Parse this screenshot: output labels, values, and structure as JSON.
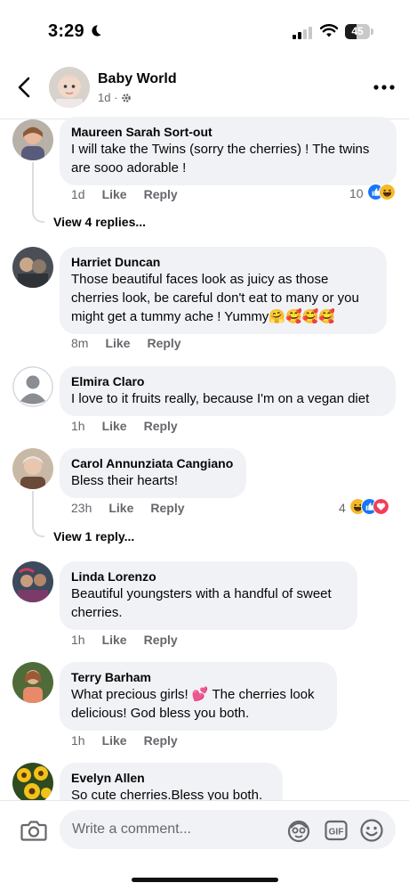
{
  "status": {
    "time": "3:29",
    "battery": "45",
    "battery_level": 0.45
  },
  "header": {
    "title": "Baby World",
    "meta": "1d ·"
  },
  "comments": [
    {
      "name": "Maureen Sarah Sort-out",
      "text": "I will take the Twins (sorry the cherries) ! The twins are sooo adorable !",
      "time": "1d",
      "like": "Like",
      "reply": "Reply",
      "reaction_count": "10",
      "view_replies": "View 4 replies..."
    },
    {
      "name": "Harriet Duncan",
      "text": "Those beautiful faces look as juicy as those cherries look, be careful don't eat to many or you might get  a tummy ache ! Yummy🤗🥰🥰🥰",
      "time": "8m",
      "like": "Like",
      "reply": "Reply"
    },
    {
      "name": "Elmira Claro",
      "text": "I love to it fruits really, because I'm on a vegan diet",
      "time": "1h",
      "like": "Like",
      "reply": "Reply"
    },
    {
      "name": "Carol Annunziata Cangiano",
      "text": "Bless their hearts!",
      "time": "23h",
      "like": "Like",
      "reply": "Reply",
      "reaction_count": "4",
      "view_replies": "View 1 reply..."
    },
    {
      "name": "Linda Lorenzo",
      "text": "Beautiful youngsters with a handful of sweet cherries.",
      "time": "1h",
      "like": "Like",
      "reply": "Reply"
    },
    {
      "name": "Terry Barham",
      "text": "What precious girls! 💕 The cherries look delicious! God bless you both.",
      "time": "1h",
      "like": "Like",
      "reply": "Reply"
    },
    {
      "name": "Evelyn Allen",
      "text": "So cute cherries.Bless you both."
    }
  ],
  "composer": {
    "placeholder": "Write a comment..."
  },
  "icons": {
    "back": "chevron-left-icon",
    "more": "more-dots-icon",
    "settings": "gear-icon",
    "camera": "camera-icon",
    "avatar_sticker": "avatar-sticker-icon",
    "gif": "gif-icon",
    "emoji": "smile-icon",
    "reactions": [
      "like-reaction-icon",
      "haha-reaction-icon",
      "love-reaction-icon"
    ]
  },
  "colors": {
    "like_blue": "#1877f2",
    "love_red": "#f33e58",
    "haha_yellow": "#f7b928",
    "bubble_bg": "#f0f2f5",
    "muted": "#65676b"
  }
}
